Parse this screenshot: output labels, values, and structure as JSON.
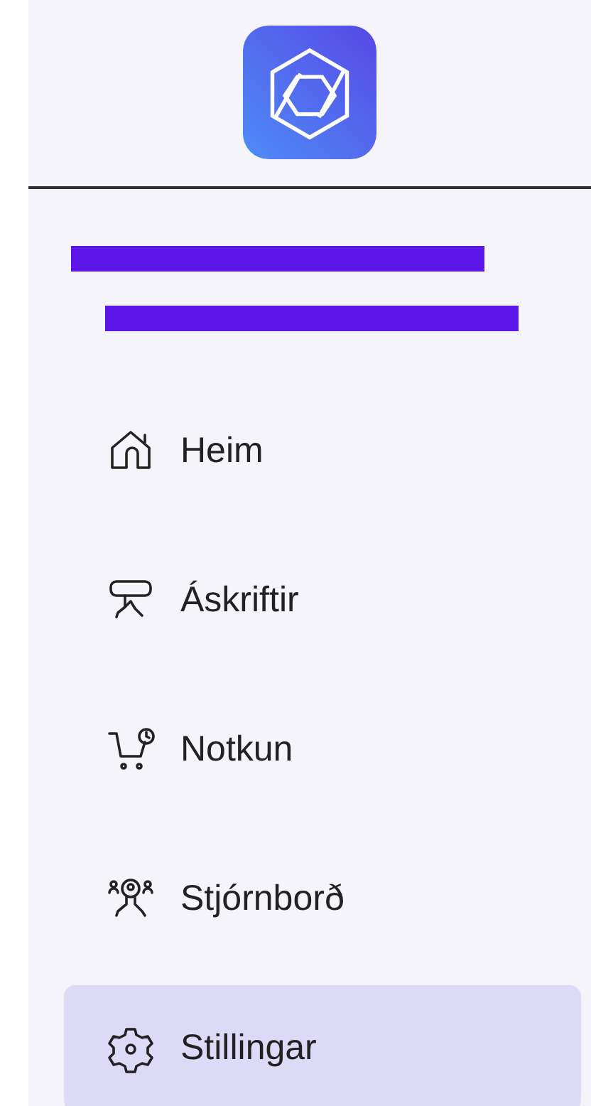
{
  "user_name_lines": [
    {
      "kind": "redacted"
    },
    {
      "kind": "redacted"
    }
  ],
  "menu": [
    {
      "label": "Heim",
      "kind": "home",
      "selected": false
    },
    {
      "label": "Áskriftir",
      "kind": "subscriptions",
      "selected": false
    },
    {
      "label": "Notkun",
      "kind": "usage",
      "selected": false
    },
    {
      "label": "Stjórnborð",
      "kind": "dashboard",
      "selected": false
    },
    {
      "label": "Stillingar",
      "kind": "settings",
      "selected": true
    }
  ]
}
